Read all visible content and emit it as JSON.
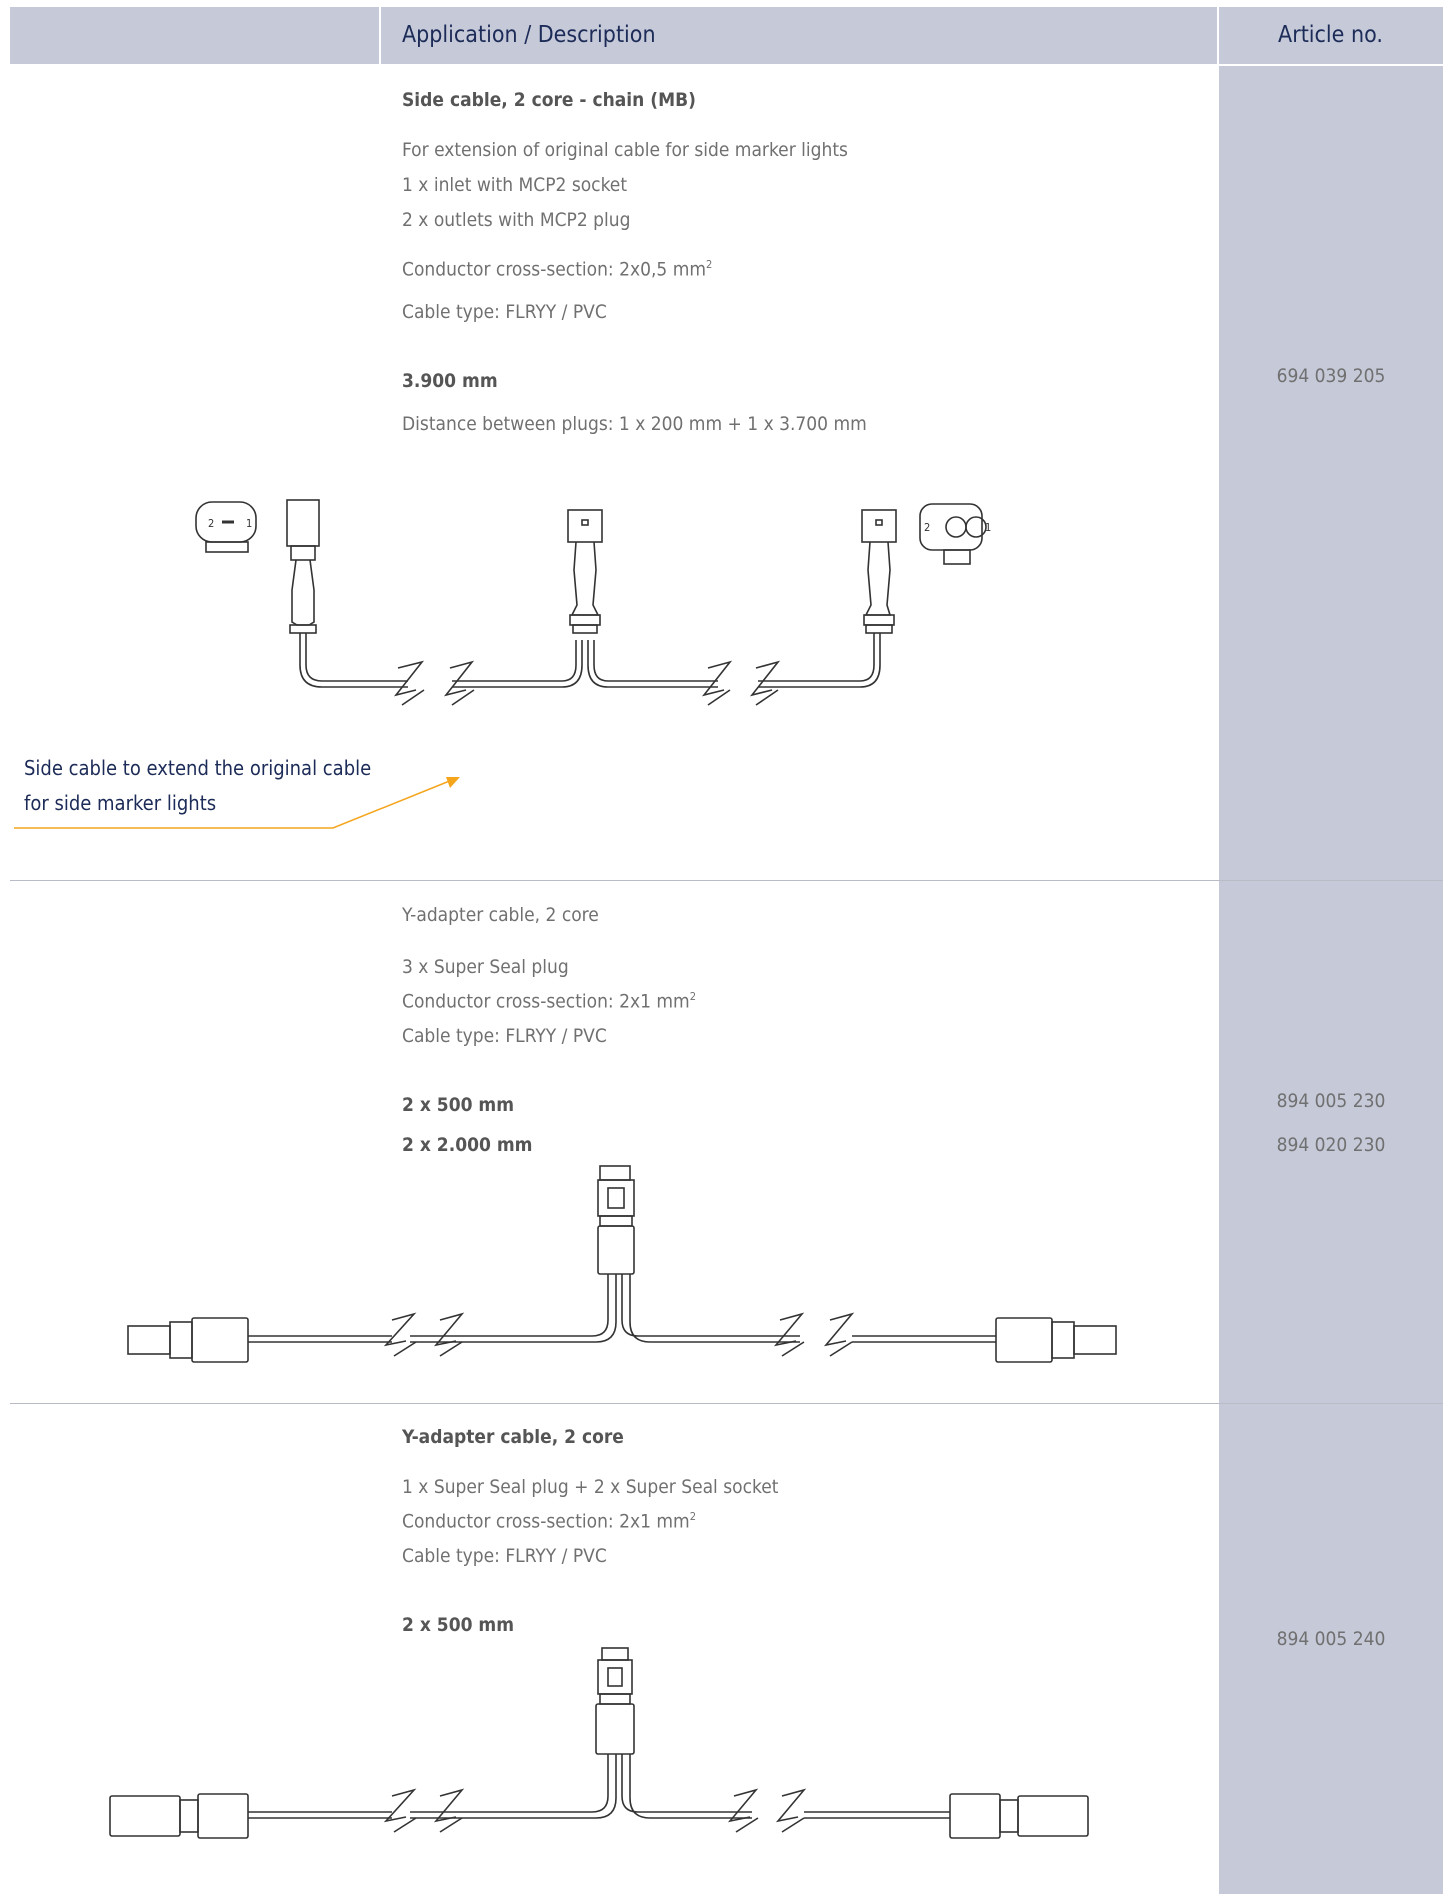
{
  "header": {
    "description_label": "Application / Description",
    "article_label": "Article no."
  },
  "products": [
    {
      "title": "Side cable, 2 core - chain (MB)",
      "lines": [
        "For extension of original cable for side marker lights",
        "1 x inlet with MCP2 socket",
        "2 x outlets with MCP2 plug"
      ],
      "cross_section": "Conductor cross-section: 2x0,5 mm",
      "cross_section_sup": "2",
      "cable_type": "Cable type: FLRYY / PVC",
      "length": "3.900 mm",
      "distance": "Distance between plugs:  1 x 200 mm + 1 x 3.700 mm",
      "article": "694 039 205",
      "callout": {
        "line1": "Side cable to extend the original cable",
        "line2": "for side marker lights",
        "color": "#f4a51c"
      },
      "pin_labels": [
        "2",
        "1",
        "2",
        "1"
      ]
    },
    {
      "title": "Y-adapter cable, 2 core",
      "lines": [
        "3 x Super Seal plug"
      ],
      "cross_section": "Conductor cross-section: 2x1 mm",
      "cross_section_sup": "2",
      "cable_type": "Cable type: FLRYY / PVC",
      "lengths": [
        "2 x   500 mm",
        "2 x 2.000 mm"
      ],
      "articles": [
        "894 005 230",
        "894 020 230"
      ]
    },
    {
      "title": "Y-adapter cable, 2 core",
      "lines": [
        "1 x Super Seal plug + 2 x Super Seal socket"
      ],
      "cross_section": "Conductor cross-section: 2x1 mm",
      "cross_section_sup": "2",
      "cable_type": "Cable type: FLRYY / PVC",
      "length": "2 x   500 mm",
      "article": "894 005 240"
    }
  ],
  "colors": {
    "header_bg": "#c5c9d8",
    "header_text": "#1c2b57",
    "body_text": "#707070",
    "accent": "#f4a51c"
  }
}
